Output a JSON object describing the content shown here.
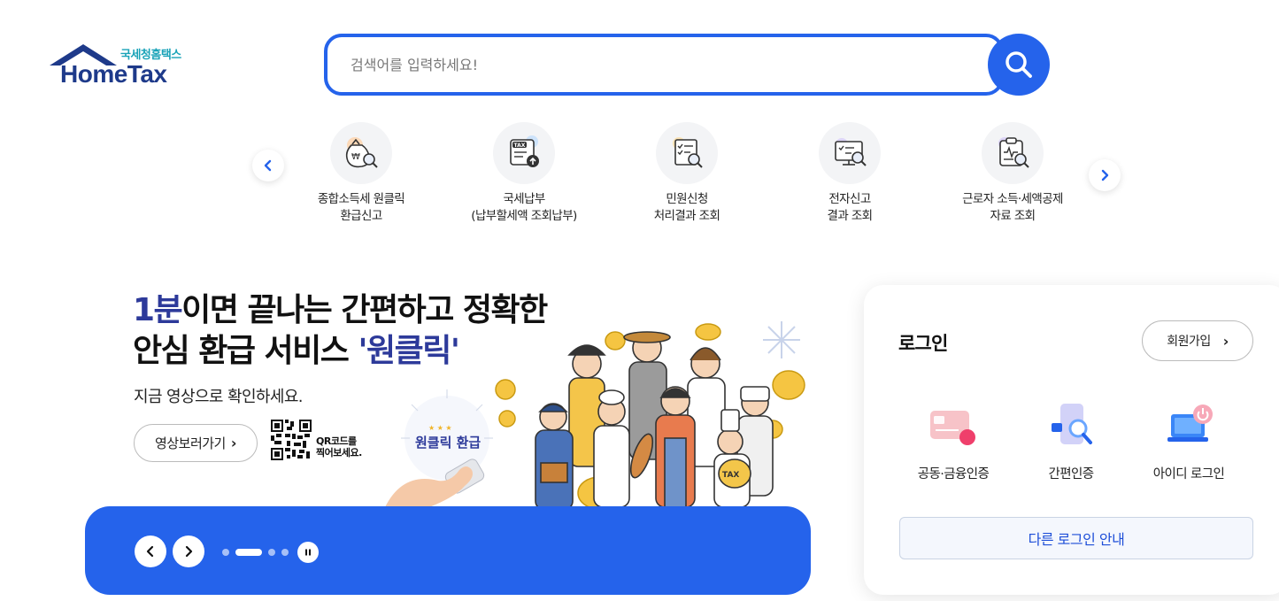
{
  "header": {
    "logo_kr": "국세청홈택스",
    "logo_en": "HomeTax",
    "search_placeholder": "검색어를 입력하세요!"
  },
  "quick_menu": {
    "items": [
      {
        "label": "종합소득세 원클릭\n환급신고",
        "icon": "money-bag-search-icon"
      },
      {
        "label": "국세납부\n(납부할세액 조회납부)",
        "icon": "tax-upload-icon"
      },
      {
        "label": "민원신청\n처리결과 조회",
        "icon": "document-search-icon"
      },
      {
        "label": "전자신고\n결과 조회",
        "icon": "monitor-search-icon"
      },
      {
        "label": "근로자 소득·세액공제\n자료 조회",
        "icon": "clipboard-search-icon"
      }
    ]
  },
  "banner": {
    "title_num": "1분",
    "title_rest1": "이면 끝나는 간편하고 정확한",
    "title_rest2": "안심 환급 서비스 ",
    "title_highlight": "'원클릭'",
    "subtitle": "지금 영상으로 확인하세요.",
    "video_button": "영상보러가기",
    "qr_text": "QR코드를\n찍어보세요.",
    "badge_text": "원클릭 환급",
    "badge_stars": "★ ★ ★"
  },
  "login": {
    "title": "로그인",
    "join_button": "회원가입",
    "options": [
      {
        "label": "공동·금융인증",
        "icon": "certificate-card-icon"
      },
      {
        "label": "간편인증",
        "icon": "phone-search-icon"
      },
      {
        "label": "아이디 로그인",
        "icon": "laptop-power-icon"
      }
    ],
    "other_login": "다른 로그인 안내"
  },
  "colors": {
    "primary": "#2563eb",
    "logo_navy": "#1e3a8a",
    "logo_teal": "#1aa3b8",
    "highlight": "#2d3a9a"
  }
}
